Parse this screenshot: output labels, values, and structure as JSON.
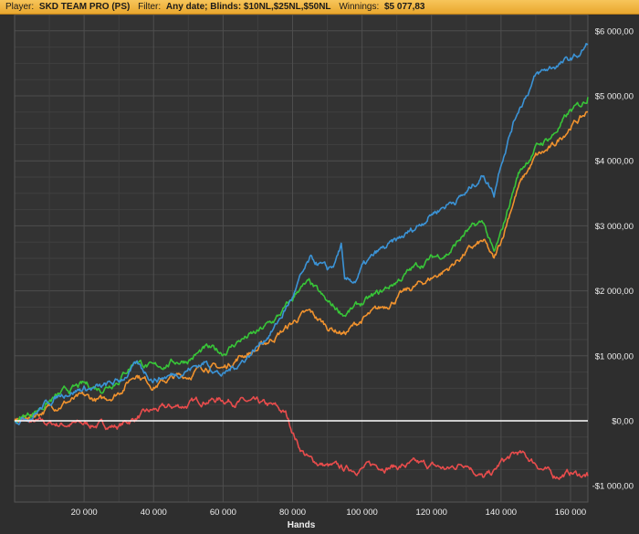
{
  "header": {
    "player_label": "Player:",
    "player_value": "SKD TEAM PRO (PS)",
    "filter_label": "Filter:",
    "filter_value": "Any date; Blinds: $10NL,$25NL,$50NL",
    "winnings_label": "Winnings:",
    "winnings_value": "$5 077,83"
  },
  "chart_data": {
    "type": "line",
    "xlabel": "Hands",
    "xlim": [
      0,
      165000
    ],
    "ylim": [
      -1250,
      6250
    ],
    "x_ticks": [
      20000,
      40000,
      60000,
      80000,
      100000,
      120000,
      140000,
      160000
    ],
    "x_tick_labels": [
      "20 000",
      "40 000",
      "60 000",
      "80 000",
      "100 000",
      "120 000",
      "140 000",
      "160 000"
    ],
    "y_ticks": [
      -1000,
      0,
      1000,
      2000,
      3000,
      4000,
      5000,
      6000
    ],
    "y_tick_labels": [
      "-$1 000,00",
      "$0,00",
      "$1 000,00",
      "$2 000,00",
      "$3 000,00",
      "$4 000,00",
      "$5 000,00",
      "$6 000,00"
    ],
    "grid": true,
    "zero_line_color": "#ffffff",
    "series": [
      {
        "color": "#e84c4c",
        "x": [
          0,
          10000,
          20000,
          30000,
          35000,
          40000,
          45000,
          50000,
          55000,
          60000,
          65000,
          70000,
          75000,
          78000,
          82000,
          85000,
          90000,
          95000,
          100000,
          105000,
          110000,
          115000,
          120000,
          125000,
          130000,
          135000,
          138000,
          140000,
          145000,
          150000,
          155000,
          160000,
          165000
        ],
        "values": [
          0,
          -50,
          -50,
          -80,
          50,
          150,
          200,
          250,
          330,
          330,
          300,
          250,
          200,
          100,
          -400,
          -600,
          -700,
          -750,
          -720,
          -680,
          -700,
          -680,
          -700,
          -750,
          -620,
          -880,
          -800,
          -650,
          -500,
          -650,
          -850,
          -800,
          -850
        ]
      },
      {
        "color": "#f0922e",
        "x": [
          0,
          5000,
          10000,
          15000,
          20000,
          25000,
          30000,
          35000,
          40000,
          45000,
          50000,
          55000,
          60000,
          65000,
          70000,
          75000,
          80000,
          82000,
          85000,
          90000,
          95000,
          100000,
          105000,
          110000,
          115000,
          120000,
          125000,
          130000,
          135000,
          138000,
          140000,
          143000,
          145000,
          150000,
          155000,
          160000,
          163000,
          165000
        ],
        "values": [
          0,
          80,
          200,
          300,
          350,
          300,
          450,
          750,
          550,
          650,
          700,
          850,
          800,
          1000,
          1100,
          1300,
          1500,
          1600,
          1650,
          1450,
          1350,
          1550,
          1700,
          1900,
          2050,
          2200,
          2350,
          2600,
          2750,
          2450,
          2750,
          3300,
          3600,
          4050,
          4200,
          4550,
          4650,
          4750
        ]
      },
      {
        "color": "#38c538",
        "x": [
          0,
          5000,
          10000,
          15000,
          20000,
          25000,
          30000,
          35000,
          40000,
          45000,
          50000,
          55000,
          60000,
          65000,
          70000,
          75000,
          80000,
          82000,
          85000,
          90000,
          95000,
          100000,
          105000,
          110000,
          115000,
          120000,
          125000,
          130000,
          135000,
          138000,
          140000,
          143000,
          145000,
          150000,
          155000,
          160000,
          163000,
          165000
        ],
        "values": [
          0,
          120,
          300,
          450,
          550,
          500,
          650,
          950,
          800,
          900,
          950,
          1100,
          1050,
          1250,
          1350,
          1550,
          1850,
          2050,
          2100,
          1800,
          1650,
          1800,
          1950,
          2150,
          2350,
          2500,
          2600,
          2900,
          3050,
          2550,
          2850,
          3450,
          3800,
          4200,
          4400,
          4750,
          4850,
          4980
        ]
      },
      {
        "color": "#3b93d6",
        "x": [
          0,
          5000,
          10000,
          15000,
          20000,
          25000,
          30000,
          35000,
          40000,
          45000,
          50000,
          55000,
          60000,
          65000,
          70000,
          75000,
          80000,
          82000,
          85000,
          88000,
          90000,
          92000,
          94000,
          95000,
          98000,
          100000,
          105000,
          110000,
          115000,
          120000,
          125000,
          130000,
          135000,
          138000,
          140000,
          143000,
          145000,
          150000,
          155000,
          160000,
          163000,
          165000
        ],
        "values": [
          0,
          100,
          300,
          450,
          500,
          500,
          600,
          850,
          650,
          700,
          800,
          900,
          700,
          900,
          1150,
          1450,
          1900,
          2150,
          2450,
          2400,
          2300,
          2400,
          2700,
          2100,
          2150,
          2350,
          2600,
          2750,
          2950,
          3200,
          3350,
          3500,
          3800,
          3500,
          4000,
          4500,
          4800,
          5300,
          5450,
          5550,
          5650,
          5800
        ]
      }
    ]
  }
}
